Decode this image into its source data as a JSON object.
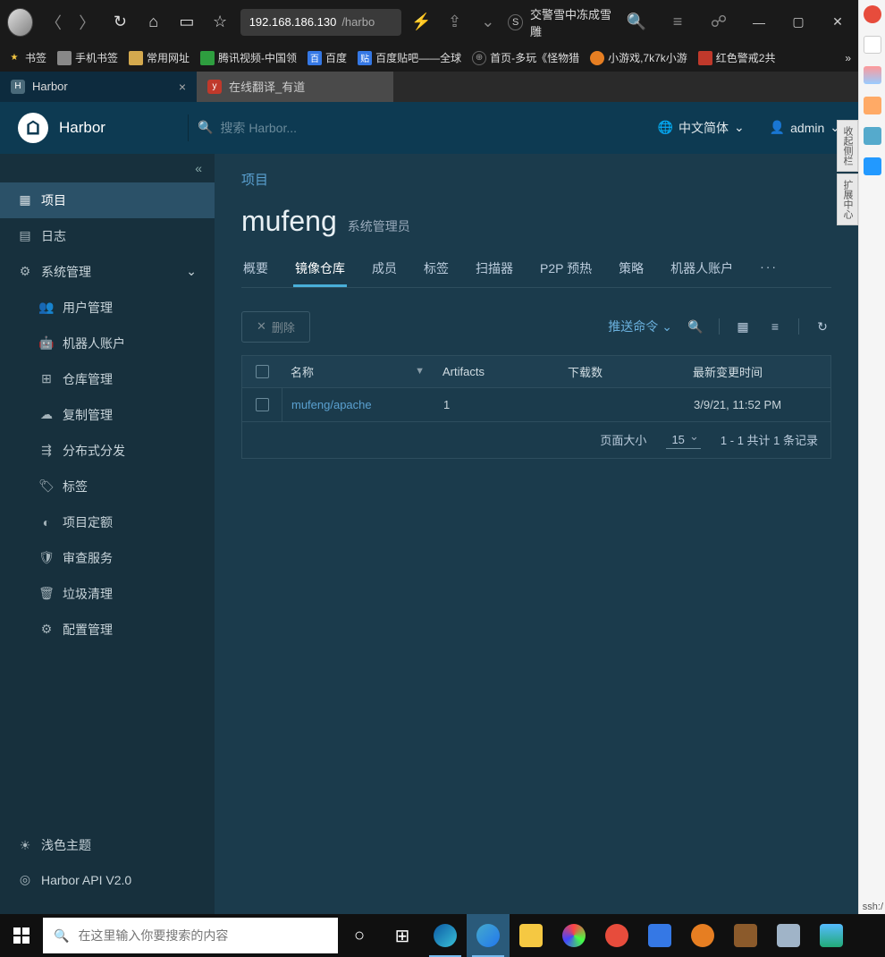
{
  "browser": {
    "url_host": "192.168.186.130",
    "url_path": "/harbo",
    "window_title": "交警雪中冻成雪雕",
    "bookmarks_label": "书签",
    "bookmarks": [
      {
        "label": "手机书签"
      },
      {
        "label": "常用网址"
      },
      {
        "label": "腾讯视频-中国领"
      },
      {
        "label": "百度"
      },
      {
        "label": "百度贴吧——全球"
      },
      {
        "label": "首页-多玩《怪物猎"
      },
      {
        "label": "小游戏,7k7k小游"
      },
      {
        "label": "红色警戒2共"
      }
    ],
    "tabs": [
      {
        "label": "Harbor",
        "active": true
      },
      {
        "label": "在线翻译_有道",
        "active": false
      }
    ]
  },
  "harbor": {
    "brand": "Harbor",
    "search_placeholder": "搜索 Harbor...",
    "language": "中文简体",
    "user": "admin",
    "sidebar": {
      "project": "项目",
      "logs": "日志",
      "sysmgmt": "系统管理",
      "users": "用户管理",
      "robots": "机器人账户",
      "registries": "仓库管理",
      "replication": "复制管理",
      "distribution": "分布式分发",
      "labels": "标签",
      "quotas": "项目定额",
      "interrogation": "审查服务",
      "gc": "垃圾清理",
      "config": "配置管理",
      "theme": "浅色主题",
      "api": "Harbor API V2.0"
    },
    "main": {
      "breadcrumb": "项目",
      "project_name": "mufeng",
      "role": "系统管理员",
      "tabs": {
        "summary": "概要",
        "repos": "镜像仓库",
        "members": "成员",
        "labels": "标签",
        "scanner": "扫描器",
        "p2p": "P2P 预热",
        "policy": "策略",
        "robots": "机器人账户"
      },
      "delete_btn": "删除",
      "push_cmd": "推送命令",
      "columns": {
        "name": "名称",
        "artifacts": "Artifacts",
        "downloads": "下载数",
        "updated": "最新变更时间"
      },
      "rows": [
        {
          "name": "mufeng/apache",
          "artifacts": "1",
          "downloads": "",
          "updated": "3/9/21, 11:52 PM"
        }
      ],
      "page_size_label": "页面大小",
      "page_size": "15",
      "pagination": "1 - 1 共计 1 条记录"
    }
  },
  "taskbar": {
    "search_placeholder": "在这里输入你要搜索的内容"
  },
  "ssh_label": "ssh:/"
}
